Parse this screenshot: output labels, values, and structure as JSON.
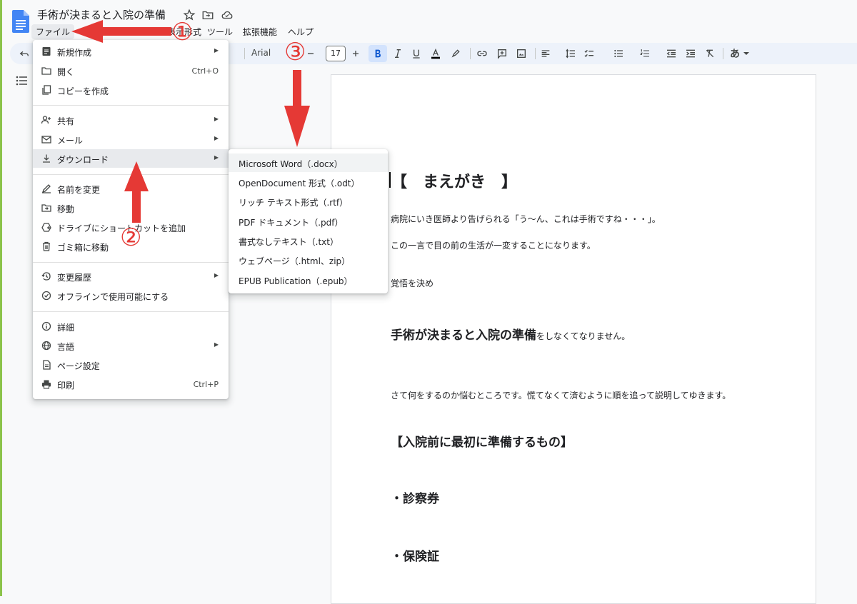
{
  "doc": {
    "title": "手術が決まると入院の準備"
  },
  "menubar": {
    "items": [
      "ファイル",
      "表示形式",
      "ツール",
      "拡張機能",
      "ヘルプ"
    ]
  },
  "toolbar": {
    "font": "Arial",
    "font_size": "17",
    "input_tools": "あ"
  },
  "file_menu": {
    "items": [
      {
        "label": "新規作成",
        "icon": "new-document-icon",
        "submenu": true
      },
      {
        "label": "開く",
        "icon": "folder-open-icon",
        "shortcut": "Ctrl+O"
      },
      {
        "label": "コピーを作成",
        "icon": "copy-icon"
      },
      {
        "label": "共有",
        "icon": "share-person-icon",
        "submenu": true
      },
      {
        "label": "メール",
        "icon": "mail-icon",
        "submenu": true
      },
      {
        "label": "ダウンロード",
        "icon": "download-icon",
        "submenu": true,
        "active": true
      },
      {
        "label": "名前を変更",
        "icon": "rename-pen-icon"
      },
      {
        "label": "移動",
        "icon": "move-folder-icon"
      },
      {
        "label": "ドライブにショートカットを追加",
        "icon": "drive-shortcut-icon"
      },
      {
        "label": "ゴミ箱に移動",
        "icon": "trash-icon"
      },
      {
        "label": "変更履歴",
        "icon": "history-icon",
        "submenu": true
      },
      {
        "label": "オフラインで使用可能にする",
        "icon": "offline-icon"
      },
      {
        "label": "詳細",
        "icon": "info-icon"
      },
      {
        "label": "言語",
        "icon": "globe-icon",
        "submenu": true
      },
      {
        "label": "ページ設定",
        "icon": "page-setup-icon"
      },
      {
        "label": "印刷",
        "icon": "print-icon",
        "shortcut": "Ctrl+P"
      }
    ]
  },
  "download_submenu": {
    "items": [
      "Microsoft Word（.docx）",
      "OpenDocument 形式（.odt）",
      "リッチ テキスト形式（.rtf）",
      "PDF ドキュメント（.pdf）",
      "書式なしテキスト（.txt）",
      "ウェブページ（.html、zip）",
      "EPUB Publication（.epub）"
    ]
  },
  "document": {
    "heading": "【　まえがき　】",
    "line1": "病院にいき医師より告げられる「う〜ん、これは手術ですね・・・」。",
    "line2": "この一言で目の前の生活が一変することになります。",
    "line3": "覚悟を決め",
    "line4_bold": "手術が決まると入院の準備",
    "line4_rest": "をしなくてなりません。",
    "line5": "さて何をするのか悩むところです。慌てなくて済むように順を追って説明してゆきます。",
    "h2_1": "【入院前に最初に準備するもの】",
    "h2_2": "・診察券",
    "h2_3": "・保険証"
  },
  "annotations": {
    "step1": "①",
    "step2": "②",
    "step3": "③",
    "color": "#e53935"
  }
}
